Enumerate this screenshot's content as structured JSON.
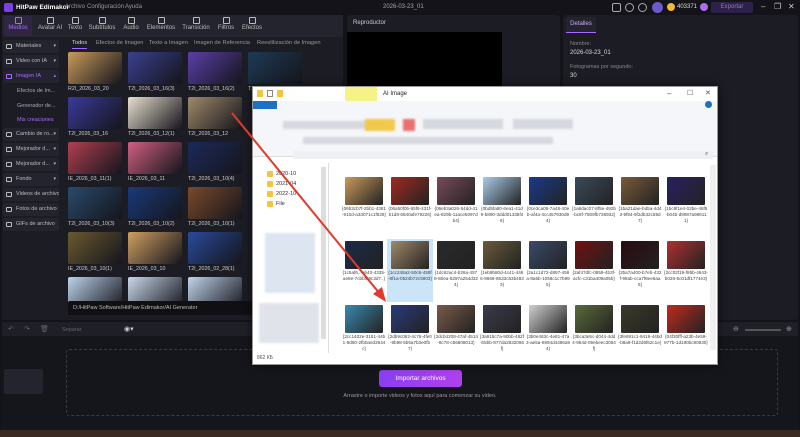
{
  "app": {
    "name": "HitPaw Edimakor",
    "menu": [
      "Archivo",
      "Configuración",
      "Ayuda"
    ],
    "project_title": "2026-03-23_01",
    "coins": "403371",
    "export_label": "Exportar"
  },
  "toolbar": {
    "tabs": [
      {
        "label": "Medios",
        "active": true
      },
      {
        "label": "Avatar AI"
      },
      {
        "label": "Texto"
      },
      {
        "label": "Subtítulos"
      },
      {
        "label": "Audio"
      },
      {
        "label": "Elementos"
      },
      {
        "label": "Transición"
      },
      {
        "label": "Filtros"
      },
      {
        "label": "Efectos"
      }
    ]
  },
  "sidebar": {
    "items": [
      {
        "label": "Materiales",
        "type": "group"
      },
      {
        "label": "Video con IA",
        "type": "group"
      },
      {
        "label": "Imagen IA",
        "type": "open"
      },
      {
        "label": "Efectos de Im...",
        "type": "sub"
      },
      {
        "label": "Generador de...",
        "type": "sub"
      },
      {
        "label": "Mis creaciones",
        "type": "selected"
      },
      {
        "label": "Cambio de ro...",
        "type": "group"
      },
      {
        "label": "Mejorador d...",
        "type": "group"
      },
      {
        "label": "Mejorador d...",
        "type": "group"
      },
      {
        "label": "Fondo",
        "type": "group"
      },
      {
        "label": "Videos de archivo",
        "type": "item"
      },
      {
        "label": "Fotos de archivo",
        "type": "item"
      },
      {
        "label": "GIFs de archivo",
        "type": "item"
      }
    ]
  },
  "media": {
    "subtabs": [
      "Todos",
      "Efectos de Imagen",
      "Texto a Imagen",
      "Imagen de Referencia",
      "Reestilización de Imagen"
    ],
    "active_subtab": "Todos",
    "items": [
      {
        "label": "R2I_2026_03_20",
        "color": "#c99a5a"
      },
      {
        "label": "T2I_2026_03_16(3)",
        "color": "#3b3f8f"
      },
      {
        "label": "T2I_2026_03_16(2)",
        "color": "#5a3fa8"
      },
      {
        "label": "T2I_2026_03_16(1)",
        "color": "#1e3a55"
      },
      {
        "label": "T2I_2026_03_16",
        "color": "#3a3a9a"
      },
      {
        "label": "T2I_2026_03_12(1)",
        "color": "#e8e0d0"
      },
      {
        "label": "T2I_2026_03_12",
        "color": "#a08a6a"
      },
      {
        "label": "",
        "color": "#2a2a34"
      },
      {
        "label": "IE_2026_03_11(1)",
        "color": "#b04050"
      },
      {
        "label": "IE_2026_03_11",
        "color": "#d06080"
      },
      {
        "label": "T2I_2026_03_10(4)",
        "color": "#1c2a5a"
      },
      {
        "label": "",
        "color": "#2a2a34"
      },
      {
        "label": "T2I_2026_03_10(3)",
        "color": "#2a4a6a"
      },
      {
        "label": "T2I_2026_03_10(2)",
        "color": "#1a3a7a"
      },
      {
        "label": "T2I_2026_03_10(1)",
        "color": "#7a4a2a"
      },
      {
        "label": "",
        "color": "#2a2a34"
      },
      {
        "label": "IE_2026_03_10(1)",
        "color": "#6a5a30"
      },
      {
        "label": "IE_2026_03_10",
        "color": "#d0a060"
      },
      {
        "label": "T2I_2026_02_28(1)",
        "color": "#2a4a9a"
      },
      {
        "label": "",
        "color": "#2a2a34"
      },
      {
        "label": "",
        "color": "#bcd4ea"
      },
      {
        "label": "",
        "color": "#c8d8e8"
      },
      {
        "label": "",
        "color": "#c0d4e8"
      },
      {
        "label": "",
        "color": "#2a2a34"
      }
    ],
    "path": "D:/HitPaw Software/HitPaw Edimakor/AI Generator"
  },
  "player": {
    "title": "Reproductor"
  },
  "details": {
    "tab": "Detalles",
    "name_label": "Nombre:",
    "name_value": "2026-03-23_01",
    "fps_label": "Fotogramas por segundo:",
    "fps_value": "30"
  },
  "timeline": {
    "split_label": "Separar",
    "import_label": "Importar archivos",
    "hint": "Arrastre o importe videos y fotos aquí para comenzar su video."
  },
  "explorer": {
    "title": "AI Image",
    "folders": [
      "2020-10",
      "2021-04",
      "2022-10",
      "File"
    ],
    "status": "862 КБ",
    "selected_index": 9,
    "files": [
      {
        "name": "{06b3cb7f-2bb1-4381-910d-a33071c1f828}",
        "color": "#c99a5a"
      },
      {
        "name": "{06a50f0b-65f8-431f-b1d8-6840afe79226}",
        "color": "#a02a20"
      },
      {
        "name": "{06eb3a026-54dd-41ea-829b-11ace5097db4}",
        "color": "#7a4a5a"
      },
      {
        "name": "{0bd5fa80-6ea1-41d9-b890-3ddd01338f46}",
        "color": "#a8cce8"
      },
      {
        "name": "{0ce3ca05-7a48-40eb-af4a-4cc457930d94}",
        "color": "#1a3a8a"
      },
      {
        "name": "{1a6dac07-8f5e-492b-bc8f-7509fb735932}",
        "color": "#3a4a5a"
      },
      {
        "name": "{1ba21dae-bd5a-4d43-9f84-9f2db32c59d7}",
        "color": "#7a5a3a"
      },
      {
        "name": "{1bc8f1e4-02be-46f5-b04b-d9987a989111}",
        "color": "#2a2060"
      },
      {
        "name": "{1c5af6..-ab40-4335-ae8e-7cbbf59c3d7..}",
        "color": "#1a2a4a"
      },
      {
        "name": "{1cc248a2-50c6-459f-8f1a-0524b72c5903}",
        "color": "#a08a6a"
      },
      {
        "name": "{1dc62ac4-b26a-4579-80ea-5297a254d324}",
        "color": "#2a2a2a"
      },
      {
        "name": "{1eb9b80d-4c41-4466-8668-8533c53b4833}",
        "color": "#6a5a3a"
      },
      {
        "name": "{2a1c1d72-d897-456a-8a6b-1058c1c7b995}",
        "color": "#3a4a6a"
      },
      {
        "name": "{2af47dfc-0859-4b3f-acfc-c31ba409a05b}",
        "color": "#701010"
      },
      {
        "name": "{2ba7a400-b7eb-432f-99ab-cca7f8ee6aa6}",
        "color": "#2a0a10"
      },
      {
        "name": "{2cc02f19-f85b-4643-b026-5c01df1774e3}",
        "color": "#b03030"
      },
      {
        "name": "{2cc1402e-3151-44b1-9d50-2fb0aed2644c}",
        "color": "#3a8ab0"
      },
      {
        "name": "{2db9c062-4c76-4fe0-9b98-5b6a7b3e0fb7}",
        "color": "#2a3a7a"
      },
      {
        "name": "{2dcb4208-47af-4514-8c78-c56808013}",
        "color": "#7a5a4a"
      },
      {
        "name": "{3a915c7a-90bb-482f-b5bb-977da2832066f}",
        "color": "#3a3a4a"
      },
      {
        "name": "{3b0e463c-4e81-47a3-ae5a-6994d4486a94}",
        "color": "#d0d0d0"
      },
      {
        "name": "{3bca3e5c-d044-4dd4-964d-09ebeec3054f}",
        "color": "#5a6a3a"
      },
      {
        "name": "{3fe691c1-9419-44bd-b8a9-f1d2d6f62c1e}",
        "color": "#3a3a2a"
      },
      {
        "name": "{04f30fff-a23b-4e59-877b-1d190bc80830}",
        "color": "#c02a20"
      }
    ]
  },
  "annotation": {
    "arrow_color": "#e03a2a"
  },
  "colors": {
    "accent": "#a56cff",
    "bg": "#131319"
  }
}
